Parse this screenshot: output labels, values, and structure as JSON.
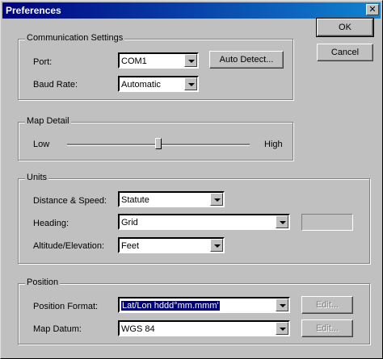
{
  "window": {
    "title": "Preferences"
  },
  "buttons": {
    "ok": "OK",
    "cancel": "Cancel"
  },
  "communication": {
    "legend": "Communication Settings",
    "port_label": "Port:",
    "port_value": "COM1",
    "auto_detect": "Auto Detect...",
    "baud_label": "Baud Rate:",
    "baud_value": "Automatic"
  },
  "map_detail": {
    "legend": "Map Detail",
    "low": "Low",
    "high": "High",
    "level": 0.5
  },
  "units": {
    "legend": "Units",
    "distance_label": "Distance & Speed:",
    "distance_value": "Statute",
    "heading_label": "Heading:",
    "heading_value": "Grid",
    "altitude_label": "Altitude/Elevation:",
    "altitude_value": "Feet"
  },
  "position": {
    "legend": "Position",
    "format_label": "Position Format:",
    "format_value": "Lat/Lon hddd°mm.mmm'",
    "edit_label": "Edit...",
    "datum_label": "Map Datum:",
    "datum_value": "WGS 84"
  }
}
